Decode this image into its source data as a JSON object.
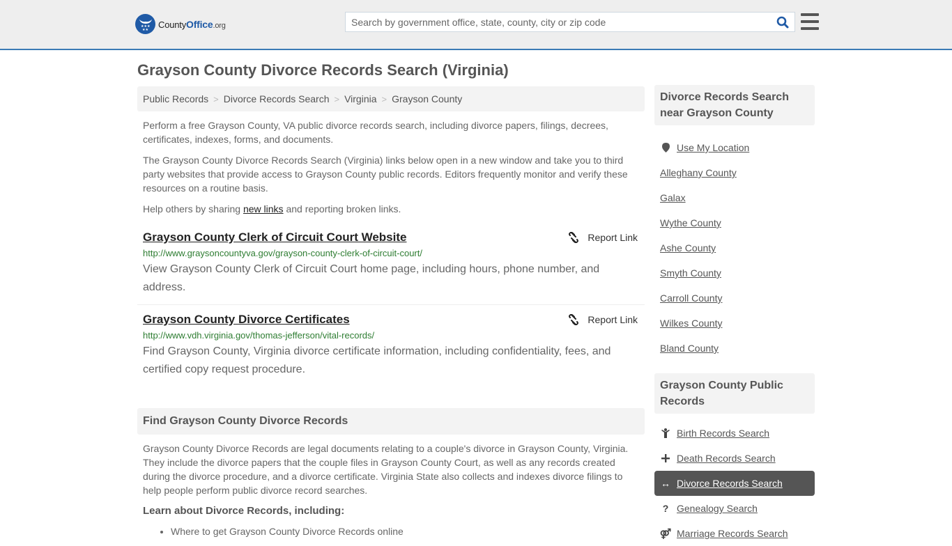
{
  "header": {
    "logo": {
      "part1": "County",
      "part2": "Office",
      "part3": ".org"
    },
    "search_placeholder": "Search by government office, state, county, city or zip code",
    "search_icon": "search-icon",
    "menu_icon": "hamburger-menu-icon"
  },
  "page_title": "Grayson County Divorce Records Search (Virginia)",
  "breadcrumb": [
    "Public Records",
    "Divorce Records Search",
    "Virginia",
    "Grayson County"
  ],
  "intro": {
    "p1": "Perform a free Grayson County, VA public divorce records search, including divorce papers, filings, decrees, certificates, indexes, forms, and documents.",
    "p2": "The Grayson County Divorce Records Search (Virginia) links below open in a new window and take you to third party websites that provide access to Grayson County public records. Editors frequently monitor and verify these resources on a routine basis.",
    "p3_before": "Help others by sharing ",
    "p3_link": "new links",
    "p3_after": " and reporting broken links."
  },
  "links": [
    {
      "title": "Grayson County Clerk of Circuit Court Website",
      "url": "http://www.graysoncountyva.gov/grayson-county-clerk-of-circuit-court/",
      "description": "View Grayson County Clerk of Circuit Court home page, including hours, phone number, and address.",
      "report_label": "Report Link"
    },
    {
      "title": "Grayson County Divorce Certificates",
      "url": "http://www.vdh.virginia.gov/thomas-jefferson/vital-records/",
      "description": "Find Grayson County, Virginia divorce certificate information, including confidentiality, fees, and certified copy request procedure.",
      "report_label": "Report Link"
    }
  ],
  "find_section": {
    "heading": "Find Grayson County Divorce Records",
    "body": "Grayson County Divorce Records are legal documents relating to a couple's divorce in Grayson County, Virginia. They include the divorce papers that the couple files in Grayson County Court, as well as any records created during the divorce procedure, and a divorce certificate. Virginia State also collects and indexes divorce filings to help people perform public divorce record searches.",
    "learn_heading": "Learn about Divorce Records, including:",
    "bullets": [
      "Where to get Grayson County Divorce Records online"
    ]
  },
  "sidebar_nearby": {
    "heading": "Divorce Records Search near Grayson County",
    "use_location": "Use My Location",
    "items": [
      "Alleghany County",
      "Galax",
      "Wythe County",
      "Ashe County",
      "Smyth County",
      "Carroll County",
      "Wilkes County",
      "Bland County"
    ]
  },
  "sidebar_public": {
    "heading": "Grayson County Public Records",
    "items": [
      {
        "label": "Birth Records Search",
        "icon": "child-icon",
        "active": false
      },
      {
        "label": "Death Records Search",
        "icon": "plus-icon",
        "active": false
      },
      {
        "label": "Divorce Records Search",
        "icon": "double-arrow-icon",
        "active": true
      },
      {
        "label": "Genealogy Search",
        "icon": "question-icon",
        "active": false
      },
      {
        "label": "Marriage Records Search",
        "icon": "marriage-icon",
        "active": false
      }
    ]
  }
}
